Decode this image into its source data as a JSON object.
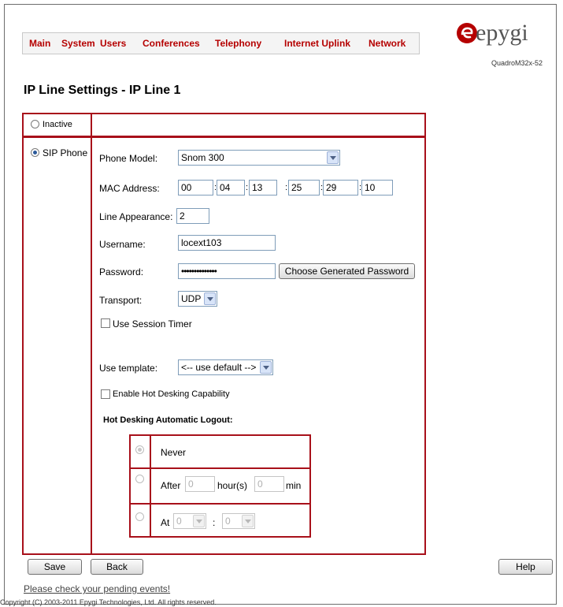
{
  "nav": [
    "Main",
    "System",
    "Users",
    "Conferences",
    "Telephony",
    "Internet Uplink",
    "Network"
  ],
  "logo": {
    "word": "epygi",
    "model": "QuadroM32x-52",
    "accent": "#b50000"
  },
  "page_title": "IP Line Settings - IP Line 1",
  "options": {
    "inactive": "Inactive",
    "sip_phone": "SIP Phone",
    "selected": "SIP Phone"
  },
  "form": {
    "phone_model_label": "Phone Model:",
    "phone_model": "Snom 300",
    "mac_label": "MAC Address:",
    "mac": [
      "00",
      "04",
      "13",
      "25",
      "29",
      "10"
    ],
    "line_appearance_label": "Line Appearance:",
    "line_appearance": "2",
    "username_label": "Username:",
    "username": "locext103",
    "password_label": "Password:",
    "password": "••••••••••••••",
    "choose_password_button": "Choose Generated Password",
    "transport_label": "Transport:",
    "transport": "UDP",
    "session_timer_label": "Use Session Timer",
    "template_label": "Use template:",
    "template": "<-- use default -->",
    "hot_desking_label": "Enable Hot Desking Capability",
    "hot_desking_logout_label": "Hot Desking Automatic Logout:",
    "logout": {
      "never": "Never",
      "after": "After",
      "after_hours": "0",
      "hours_unit": "hour(s)",
      "after_min": "0",
      "min_unit": "min",
      "at": "At",
      "at_hour": "0",
      "at_colon": ":",
      "at_min": "0"
    }
  },
  "buttons": {
    "save": "Save",
    "back": "Back",
    "help": "Help"
  },
  "pending_link": "Please check your pending events!",
  "copyright": "Copyright (C) 2003-2011 Epygi Technologies, Ltd. All rights reserved."
}
